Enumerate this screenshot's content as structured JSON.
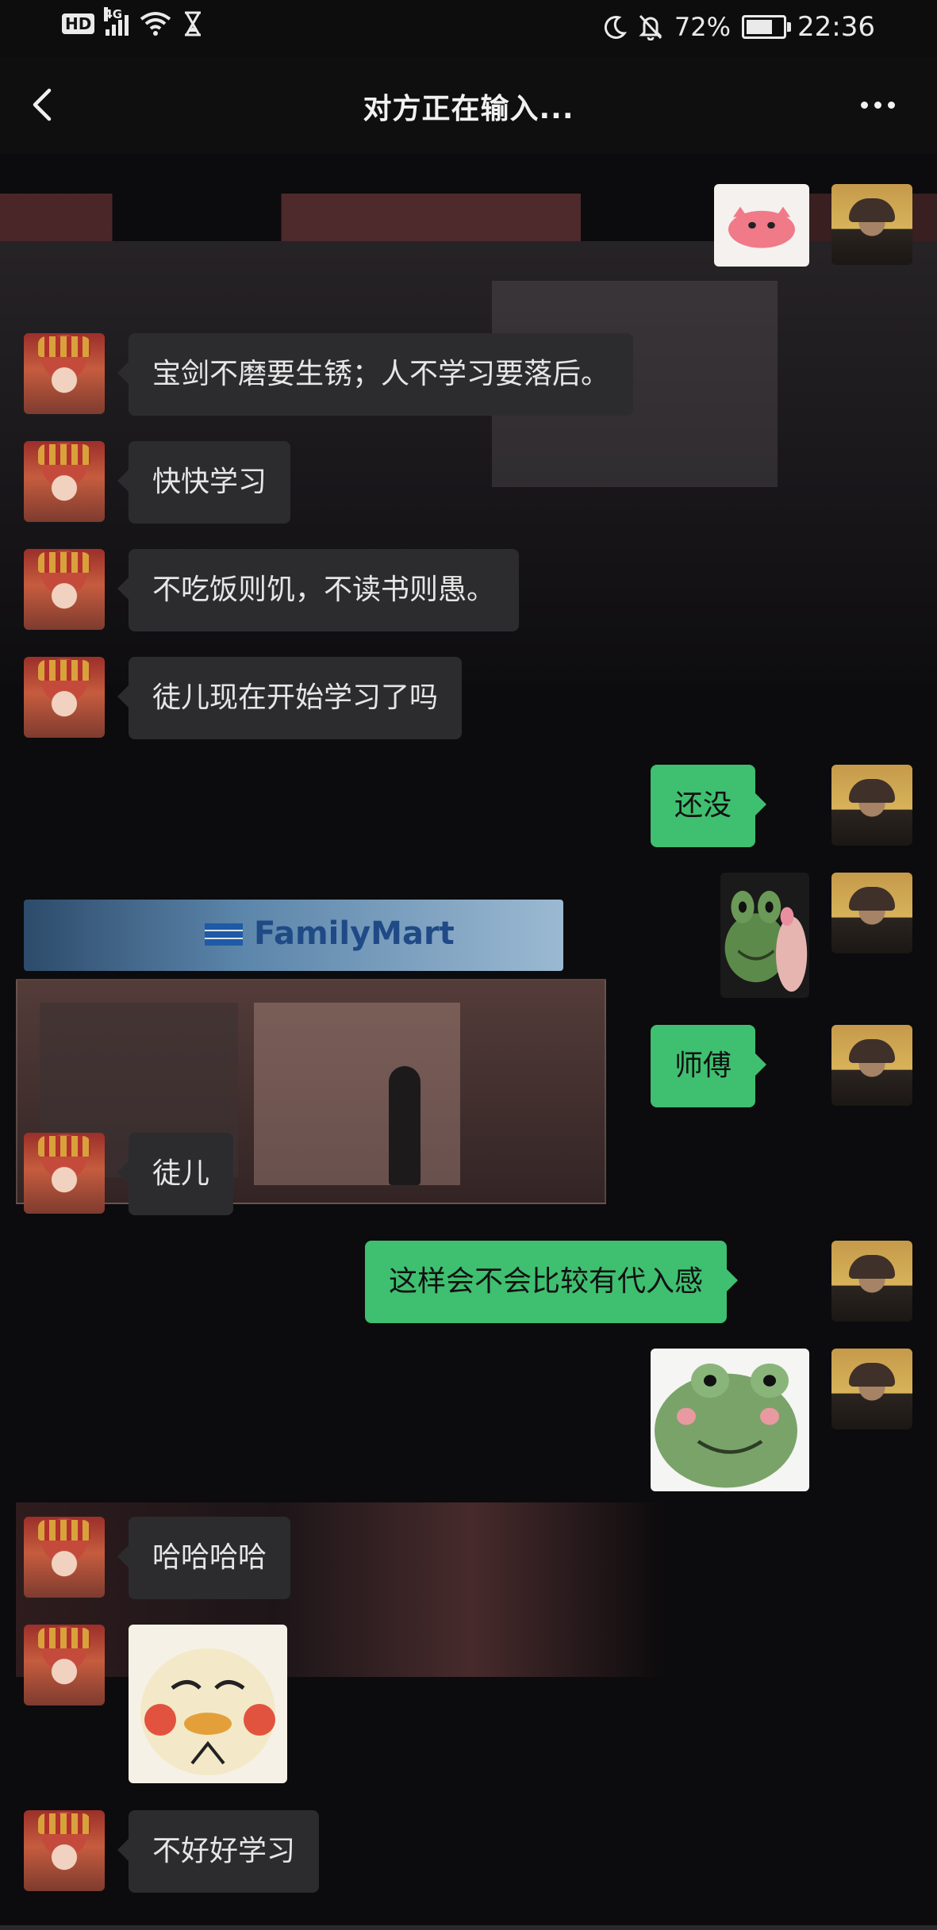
{
  "status_bar": {
    "hd_label": "HD",
    "network_label": "4G",
    "battery_percent": "72%",
    "battery_level": 0.72,
    "time": "22:36",
    "icons": [
      "wifi-icon",
      "hourglass-icon",
      "moon-icon",
      "mute-bell-icon",
      "battery-icon"
    ]
  },
  "header": {
    "title": "对方正在输入...",
    "back_icon": "chevron-left-icon",
    "more_icon": "more-dots-icon"
  },
  "background": {
    "store_sign": "FamilyMart"
  },
  "colors": {
    "bubble_right": "#3fbf70",
    "bubble_left": "#2c2c2e",
    "background": "#0a0a0b"
  },
  "messages": [
    {
      "side": "right",
      "kind": "sticker",
      "sticker": "pink-cat-sticker"
    },
    {
      "side": "left",
      "kind": "text",
      "text": "宝剑不磨要生锈；人不学习要落后。"
    },
    {
      "side": "left",
      "kind": "text",
      "text": "快快学习"
    },
    {
      "side": "left",
      "kind": "text",
      "text": "不吃饭则饥，不读书则愚。"
    },
    {
      "side": "left",
      "kind": "text",
      "text": "徒儿现在开始学习了吗"
    },
    {
      "side": "right",
      "kind": "text",
      "text": "还没"
    },
    {
      "side": "right",
      "kind": "sticker",
      "sticker": "frog-with-flower-sticker"
    },
    {
      "side": "right",
      "kind": "text",
      "text": "师傅"
    },
    {
      "side": "left",
      "kind": "text",
      "text": "徒儿"
    },
    {
      "side": "right",
      "kind": "text",
      "text": "这样会不会比较有代入感"
    },
    {
      "side": "right",
      "kind": "sticker",
      "sticker": "blushing-frog-sticker"
    },
    {
      "side": "left",
      "kind": "text",
      "text": "哈哈哈哈"
    },
    {
      "side": "left",
      "kind": "sticker",
      "sticker": "blushing-duck-sticker"
    },
    {
      "side": "left",
      "kind": "text",
      "text": "不好好学习"
    }
  ]
}
